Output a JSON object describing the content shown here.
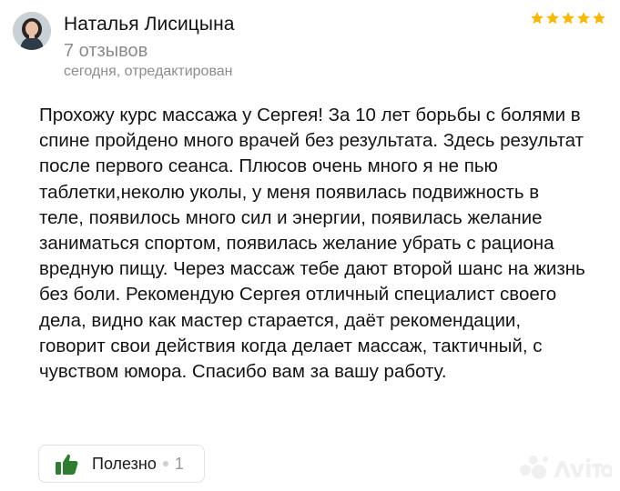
{
  "review": {
    "author_name": "Наталья Лисицына",
    "review_count": "7 отзывов",
    "date": "сегодня, отредактирован",
    "rating": 5,
    "rating_max": 5,
    "star_color": "#f6b802",
    "text": "Прохожу курс массажа у Сергея! За 10 лет борьбы с болями в спине пройдено много врачей без результата. Здесь результат после первого сеанса. Плюсов очень много я не пью таблетки,неколю уколы, у меня появилась подвижность в теле, появилось много сил и энергии, появилась желание заниматься спортом, появилась желание убрать с рациона вредную пищу. Через массаж тебе дают второй шанс на жизнь без боли. Рекомендую Сергея отличный специалист своего дела, видно как мастер старается, даёт рекомендации, говорит свои действия когда делает массаж, тактичный, с чувством юмора. Спасибо вам за вашу работу."
  },
  "helpful": {
    "label": "Полезно",
    "count": "1",
    "icon": "thumbs-up-icon",
    "icon_color": "#2e7d32"
  },
  "watermark": {
    "icon": "avito-logo-icon"
  }
}
